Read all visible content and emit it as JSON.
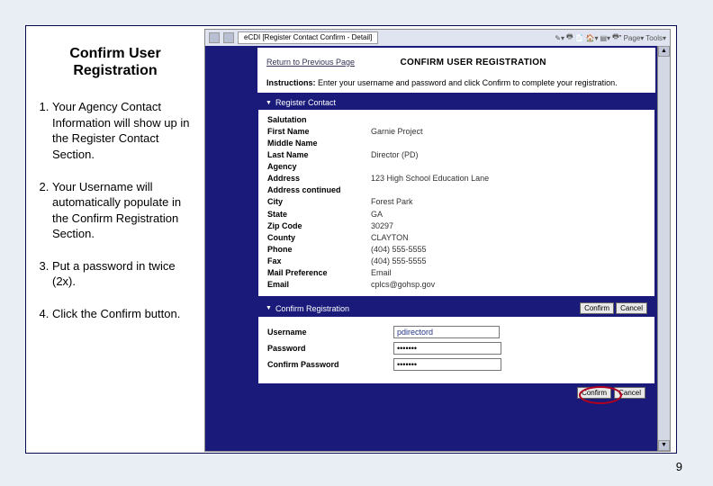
{
  "slide": {
    "title_line1": "Confirm User",
    "title_line2": "Registration",
    "steps": [
      "Your Agency Contact Information will show up in the Register Contact Section.",
      "Your Username will automatically populate in the Confirm Registration Section.",
      "Put a password in twice (2x).",
      "Click the Confirm button."
    ],
    "page_number": "9"
  },
  "app": {
    "tab_label": "eCDI [Register Contact Confirm - Detail]",
    "return_link": "Return to Previous Page",
    "page_title": "CONFIRM USER REGISTRATION",
    "instructions_label": "Instructions:",
    "instructions_text": "Enter your username and password and click Confirm to complete your registration."
  },
  "register_contact": {
    "panel_title": "Register Contact",
    "fields": [
      {
        "label": "Salutation",
        "value": ""
      },
      {
        "label": "First Name",
        "value": "Garnie Project"
      },
      {
        "label": "Middle Name",
        "value": ""
      },
      {
        "label": "Last Name",
        "value": "Director (PD)"
      },
      {
        "label": "Agency",
        "value": ""
      },
      {
        "label": "Address",
        "value": "123 High School Education Lane"
      },
      {
        "label": "Address continued",
        "value": ""
      },
      {
        "label": "City",
        "value": "Forest Park"
      },
      {
        "label": "State",
        "value": "GA"
      },
      {
        "label": "Zip Code",
        "value": "30297"
      },
      {
        "label": "County",
        "value": "CLAYTON"
      },
      {
        "label": "Phone",
        "value": "(404) 555-5555"
      },
      {
        "label": "Fax",
        "value": "(404) 555-5555"
      },
      {
        "label": "Mail Preference",
        "value": "Email"
      },
      {
        "label": "Email",
        "value": "cplcs@gohsp.gov"
      }
    ]
  },
  "confirm_registration": {
    "panel_title": "Confirm Registration",
    "confirm_btn": "Confirm",
    "cancel_btn": "Cancel",
    "username_label": "Username",
    "username_value": "pdirectord",
    "password_label": "Password",
    "password_value": "•••••••",
    "confirm_password_label": "Confirm Password",
    "confirm_password_value": "•••••••"
  }
}
